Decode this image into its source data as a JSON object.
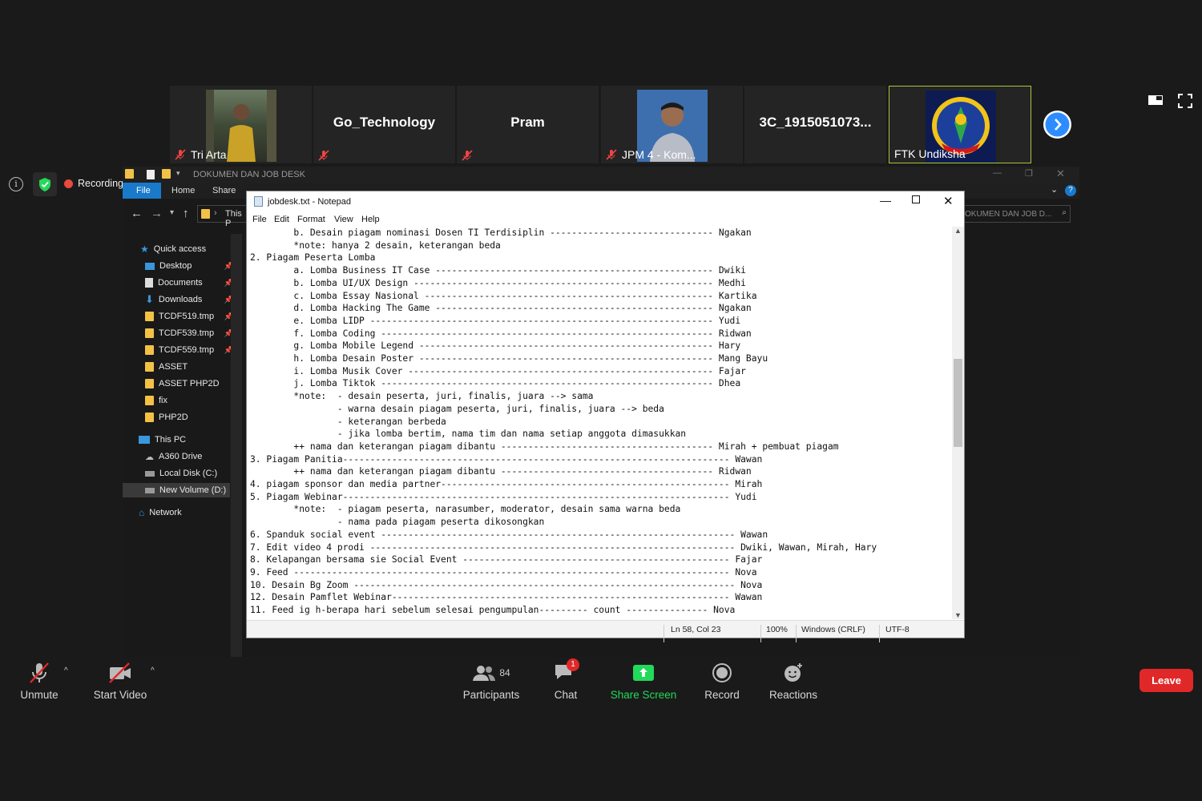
{
  "participants": [
    {
      "name": "Tri Arta",
      "muted": true,
      "has_video": true
    },
    {
      "name": "Go_Technology",
      "muted": true,
      "has_video": false
    },
    {
      "name": "Pram",
      "muted": true,
      "has_video": false
    },
    {
      "name": "JPM 4 - Kom...",
      "muted": true,
      "has_video": true
    },
    {
      "name": "3C_1915051073...",
      "muted": false,
      "has_video": false
    },
    {
      "name": "FTK Undiksha",
      "muted": false,
      "has_video": true,
      "active_speaker": true
    }
  ],
  "recording_label": "Recording",
  "explorer": {
    "title": "DOKUMEN DAN JOB DESK",
    "ribbon": {
      "file": "File",
      "home": "Home",
      "share": "Share"
    },
    "address_partial": "This P",
    "search_partial": "OKUMEN DAN JOB D...",
    "nav": {
      "quick_access": "Quick access",
      "items": [
        {
          "label": "Desktop",
          "pinned": true,
          "icon": "desktop-icon"
        },
        {
          "label": "Documents",
          "pinned": true,
          "icon": "documents-icon"
        },
        {
          "label": "Downloads",
          "pinned": true,
          "icon": "downloads-icon"
        },
        {
          "label": "TCDF519.tmp",
          "pinned": true,
          "icon": "folder-icon"
        },
        {
          "label": "TCDF539.tmp",
          "pinned": true,
          "icon": "folder-icon"
        },
        {
          "label": "TCDF559.tmp",
          "pinned": true,
          "icon": "folder-icon"
        },
        {
          "label": "ASSET",
          "pinned": false,
          "icon": "folder-icon"
        },
        {
          "label": "ASSET PHP2D",
          "pinned": false,
          "icon": "folder-icon"
        },
        {
          "label": "fix",
          "pinned": false,
          "icon": "folder-icon"
        },
        {
          "label": "PHP2D",
          "pinned": false,
          "icon": "folder-icon"
        }
      ],
      "this_pc": "This PC",
      "pc_items": [
        "A360 Drive",
        "Local Disk (C:)",
        "New Volume (D:)"
      ],
      "network": "Network"
    }
  },
  "notepad": {
    "title": "jobdesk.txt - Notepad",
    "menu": [
      "File",
      "Edit",
      "Format",
      "View",
      "Help"
    ],
    "lines": [
      "        b. Desain piagam nominasi Dosen TI Terdisiplin ------------------------------ Ngakan",
      "        *note: hanya 2 desain, keterangan beda",
      "2. Piagam Peserta Lomba",
      "        a. Lomba Business IT Case --------------------------------------------------- Dwiki",
      "        b. Lomba UI/UX Design ------------------------------------------------------- Medhi",
      "        c. Lomba Essay Nasional ----------------------------------------------------- Kartika",
      "        d. Lomba Hacking The Game --------------------------------------------------- Ngakan",
      "        e. Lomba LIDP --------------------------------------------------------------- Yudi",
      "        f. Lomba Coding ------------------------------------------------------------- Ridwan",
      "        g. Lomba Mobile Legend ------------------------------------------------------ Hary",
      "        h. Lomba Desain Poster ------------------------------------------------------ Mang Bayu",
      "        i. Lomba Musik Cover -------------------------------------------------------- Fajar",
      "        j. Lomba Tiktok ------------------------------------------------------------- Dhea",
      "        *note:  - desain peserta, juri, finalis, juara --> sama",
      "                - warna desain piagam peserta, juri, finalis, juara --> beda",
      "                - keterangan berbeda",
      "                - jika lomba bertim, nama tim dan nama setiap anggota dimasukkan",
      "        ++ nama dan keterangan piagam dibantu --------------------------------------- Mirah + pembuat piagam",
      "3. Piagam Panitia----------------------------------------------------------------------- Wawan",
      "        ++ nama dan keterangan piagam dibantu --------------------------------------- Ridwan",
      "4. piagam sponsor dan media partner----------------------------------------------------- Mirah",
      "5. Piagam Webinar----------------------------------------------------------------------- Yudi",
      "        *note:  - piagam peserta, narasumber, moderator, desain sama warna beda",
      "                - nama pada piagam peserta dikosongkan",
      "6. Spanduk social event ----------------------------------------------------------------- Wawan",
      "7. Edit video 4 prodi ------------------------------------------------------------------- Dwiki, Wawan, Mirah, Hary",
      "8. Kelapangan bersama sie Social Event ------------------------------------------------- Fajar",
      "9. Feed -------------------------------------------------------------------------------- Nova",
      "10. Desain Bg Zoom ---------------------------------------------------------------------- Nova",
      "12. Desain Pamflet Webinar-------------------------------------------------------------- Wawan",
      "11. Feed ig h-berapa hari sebelum selesai pengumpulan--------- count --------------- Nova"
    ],
    "status": {
      "position": "Ln 58, Col 23",
      "zoom": "100%",
      "eol": "Windows (CRLF)",
      "encoding": "UTF-8"
    }
  },
  "toolbar": {
    "unmute": "Unmute",
    "start_video": "Start Video",
    "participants": "Participants",
    "participants_count": "84",
    "chat": "Chat",
    "chat_badge": "1",
    "share_screen": "Share Screen",
    "record": "Record",
    "reactions": "Reactions",
    "leave": "Leave"
  },
  "colors": {
    "share_green": "#23d959",
    "leave_red": "#e02828",
    "next_blue": "#2d8cff",
    "active_border": "#a6c837"
  }
}
